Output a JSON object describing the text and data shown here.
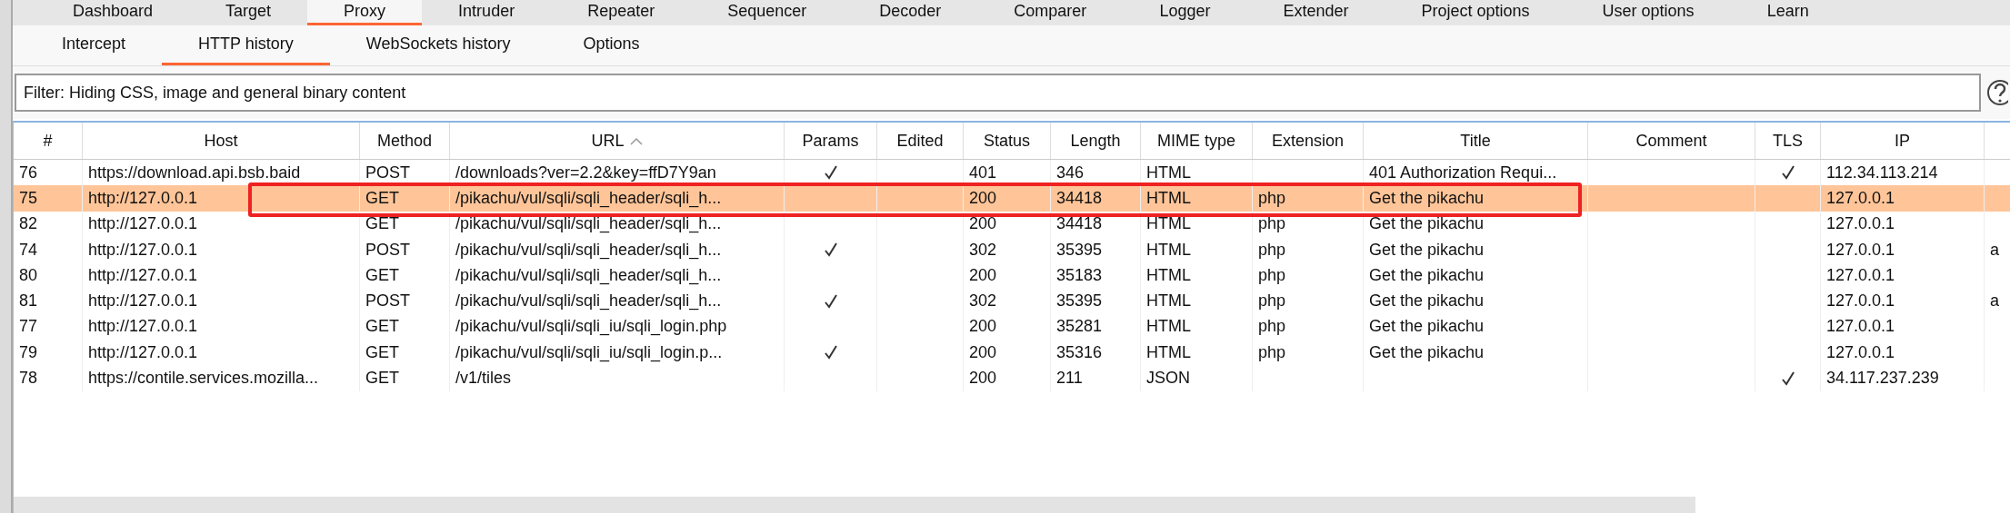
{
  "tabs": [
    {
      "label": "Dashboard",
      "selected": false
    },
    {
      "label": "Target",
      "selected": false
    },
    {
      "label": "Proxy",
      "selected": true
    },
    {
      "label": "Intruder",
      "selected": false
    },
    {
      "label": "Repeater",
      "selected": false
    },
    {
      "label": "Sequencer",
      "selected": false
    },
    {
      "label": "Decoder",
      "selected": false
    },
    {
      "label": "Comparer",
      "selected": false
    },
    {
      "label": "Logger",
      "selected": false
    },
    {
      "label": "Extender",
      "selected": false
    },
    {
      "label": "Project options",
      "selected": false
    },
    {
      "label": "User options",
      "selected": false
    },
    {
      "label": "Learn",
      "selected": false
    }
  ],
  "subtabs": [
    {
      "label": "Intercept",
      "selected": false
    },
    {
      "label": "HTTP history",
      "selected": true
    },
    {
      "label": "WebSockets history",
      "selected": false
    },
    {
      "label": "Options",
      "selected": false
    }
  ],
  "filter": {
    "text": "Filter: Hiding CSS, image and general binary content"
  },
  "table": {
    "columns": [
      {
        "label": "#",
        "sorted": false
      },
      {
        "label": "Host",
        "sorted": false
      },
      {
        "label": "Method",
        "sorted": false
      },
      {
        "label": "URL",
        "sorted": true
      },
      {
        "label": "Params",
        "sorted": false
      },
      {
        "label": "Edited",
        "sorted": false
      },
      {
        "label": "Status",
        "sorted": false
      },
      {
        "label": "Length",
        "sorted": false
      },
      {
        "label": "MIME type",
        "sorted": false
      },
      {
        "label": "Extension",
        "sorted": false
      },
      {
        "label": "Title",
        "sorted": false
      },
      {
        "label": "Comment",
        "sorted": false
      },
      {
        "label": "TLS",
        "sorted": false
      },
      {
        "label": "IP",
        "sorted": false
      },
      {
        "sorted": false
      }
    ],
    "rows": [
      {
        "selected": false,
        "num": "76",
        "host": "https://download.api.bsb.baid",
        "method": "POST",
        "url": "/downloads?ver=2.2&key=ffD7Y9an",
        "params": true,
        "status": "401",
        "length": "346",
        "mime_type": "HTML",
        "title": "401 Authorization Requi...",
        "tls": true,
        "ip": "112.34.113.214"
      },
      {
        "selected": true,
        "num": "75",
        "host": "http://127.0.0.1",
        "method": "GET",
        "url": "/pikachu/vul/sqli/sqli_header/sqli_h...",
        "params": false,
        "status": "200",
        "length": "34418",
        "mime_type": "HTML",
        "extension": "php",
        "title": "Get the pikachu",
        "tls": false,
        "ip": "127.0.0.1"
      },
      {
        "selected": false,
        "num": "82",
        "host": "http://127.0.0.1",
        "method": "GET",
        "url": "/pikachu/vul/sqli/sqli_header/sqli_h...",
        "params": false,
        "status": "200",
        "length": "34418",
        "mime_type": "HTML",
        "extension": "php",
        "title": "Get the pikachu",
        "tls": false,
        "ip": "127.0.0.1"
      },
      {
        "selected": false,
        "num": "74",
        "host": "http://127.0.0.1",
        "method": "POST",
        "url": "/pikachu/vul/sqli/sqli_header/sqli_h...",
        "params": true,
        "status": "302",
        "length": "35395",
        "mime_type": "HTML",
        "extension": "php",
        "title": "Get the pikachu",
        "tls": false,
        "ip": "127.0.0.1",
        "column_15": "a"
      },
      {
        "selected": false,
        "num": "80",
        "host": "http://127.0.0.1",
        "method": "GET",
        "url": "/pikachu/vul/sqli/sqli_header/sqli_h...",
        "params": false,
        "status": "200",
        "length": "35183",
        "mime_type": "HTML",
        "extension": "php",
        "title": "Get the pikachu",
        "tls": false,
        "ip": "127.0.0.1"
      },
      {
        "selected": false,
        "num": "81",
        "host": "http://127.0.0.1",
        "method": "POST",
        "url": "/pikachu/vul/sqli/sqli_header/sqli_h...",
        "params": true,
        "status": "302",
        "length": "35395",
        "mime_type": "HTML",
        "extension": "php",
        "title": "Get the pikachu",
        "tls": false,
        "ip": "127.0.0.1",
        "column_15": "a"
      },
      {
        "selected": false,
        "num": "77",
        "host": "http://127.0.0.1",
        "method": "GET",
        "url": "/pikachu/vul/sqli/sqli_iu/sqli_login.php",
        "params": false,
        "status": "200",
        "length": "35281",
        "mime_type": "HTML",
        "extension": "php",
        "title": "Get the pikachu",
        "tls": false,
        "ip": "127.0.0.1"
      },
      {
        "selected": false,
        "num": "79",
        "host": "http://127.0.0.1",
        "method": "GET",
        "url": "/pikachu/vul/sqli/sqli_iu/sqli_login.p...",
        "params": true,
        "status": "200",
        "length": "35316",
        "mime_type": "HTML",
        "extension": "php",
        "title": "Get the pikachu",
        "tls": false,
        "ip": "127.0.0.1"
      },
      {
        "selected": false,
        "num": "78",
        "host": "https://contile.services.mozilla...",
        "method": "GET",
        "url": "/v1/tiles",
        "params": false,
        "status": "200",
        "length": "211",
        "mime_type": "JSON",
        "tls": true,
        "ip": "34.117.237.239"
      }
    ]
  },
  "highlight_box": {
    "color": "#ee2222"
  }
}
